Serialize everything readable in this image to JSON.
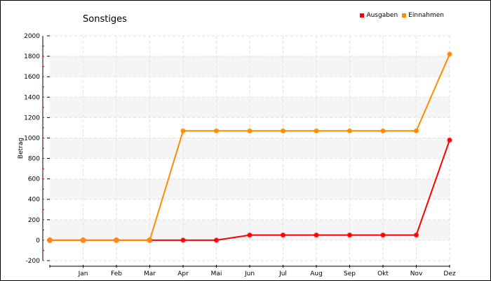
{
  "chart_data": {
    "type": "line",
    "title": "Sonstiges",
    "xlabel": "",
    "ylabel": "Betrag",
    "categories": [
      "",
      "Jan",
      "Feb",
      "Mar",
      "Apr",
      "Mai",
      "Jun",
      "Jul",
      "Aug",
      "Sep",
      "Okt",
      "Nov",
      "Dez"
    ],
    "ylim": [
      -200,
      2000
    ],
    "yticks": [
      -200,
      0,
      200,
      400,
      600,
      800,
      1000,
      1200,
      1400,
      1600,
      1800,
      2000
    ],
    "grid": true,
    "legend_position": "top-right",
    "series": [
      {
        "name": "Ausgaben",
        "color": "#ff0000",
        "values": [
          0,
          0,
          0,
          0,
          0,
          0,
          50,
          50,
          50,
          50,
          50,
          50,
          980
        ]
      },
      {
        "name": "Einnahmen",
        "color": "#ff8c00",
        "values": [
          0,
          0,
          0,
          0,
          1070,
          1070,
          1070,
          1070,
          1070,
          1070,
          1070,
          1070,
          1820
        ]
      }
    ]
  }
}
